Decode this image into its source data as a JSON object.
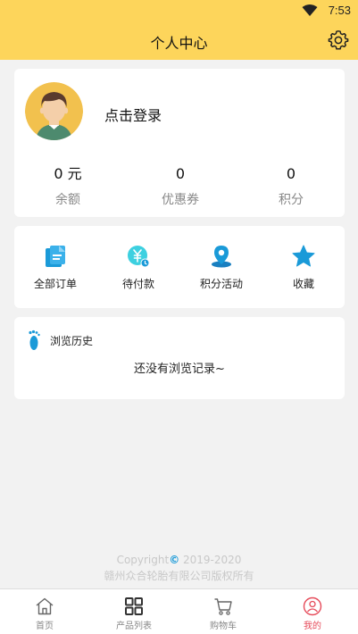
{
  "status_bar": {
    "time": "7:53",
    "wifi_icon": "wifi-icon"
  },
  "header": {
    "title": "个人中心",
    "settings_icon": "gear-icon"
  },
  "profile": {
    "avatar_icon": "avatar-icon",
    "login_label": "点击登录",
    "stats": [
      {
        "value": "0 元",
        "label": "余额"
      },
      {
        "value": "0",
        "label": "优惠券"
      },
      {
        "value": "0",
        "label": "积分"
      }
    ]
  },
  "menu": {
    "items": [
      {
        "label": "全部订单",
        "icon": "orders-icon"
      },
      {
        "label": "待付款",
        "icon": "yen-pending-icon"
      },
      {
        "label": "积分活动",
        "icon": "location-pin-icon"
      },
      {
        "label": "收藏",
        "icon": "star-icon"
      }
    ]
  },
  "history": {
    "title": "浏览历史",
    "empty_text": "还没有浏览记录~",
    "icon": "footprint-icon"
  },
  "footer": {
    "copyright_prefix": "Copyright",
    "copyright_mark": "©",
    "copyright_years": " 2019-2020",
    "company": "赣州众合轮胎有限公司版权所有"
  },
  "tabbar": {
    "tabs": [
      {
        "label": "首页",
        "icon": "home-icon",
        "active": false
      },
      {
        "label": "产品列表",
        "icon": "grid-icon",
        "active": false
      },
      {
        "label": "购物车",
        "icon": "cart-icon",
        "active": false
      },
      {
        "label": "我的",
        "icon": "user-circle-icon",
        "active": true
      }
    ]
  },
  "colors": {
    "header_bg": "#fdd55b",
    "accent_blue": "#1a9ad8",
    "active_tab": "#e64b5a"
  }
}
